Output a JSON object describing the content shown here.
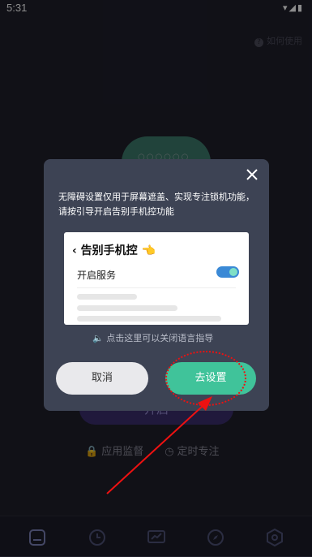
{
  "status": {
    "time": "5:31"
  },
  "faq": "如何使用",
  "background": {
    "start_label": "开启",
    "links": [
      {
        "icon": "lock-icon",
        "label": "应用监督"
      },
      {
        "icon": "clock-icon",
        "label": "定时专注"
      }
    ]
  },
  "dialog": {
    "description": "无障碍设置仅用于屏幕遮盖、实现专注锁机功能，请按引导开启告别手机控功能",
    "preview": {
      "title": "告别手机控",
      "row_label": "开启服务"
    },
    "voice_hint": "点击这里可以关闭语言指导",
    "cancel_label": "取消",
    "confirm_label": "去设置"
  },
  "tabs": [
    "home-icon",
    "clock-icon",
    "chart-icon",
    "compass-icon",
    "settings-icon"
  ],
  "colors": {
    "accent": "#40c39a",
    "annotation": "#e11111"
  }
}
